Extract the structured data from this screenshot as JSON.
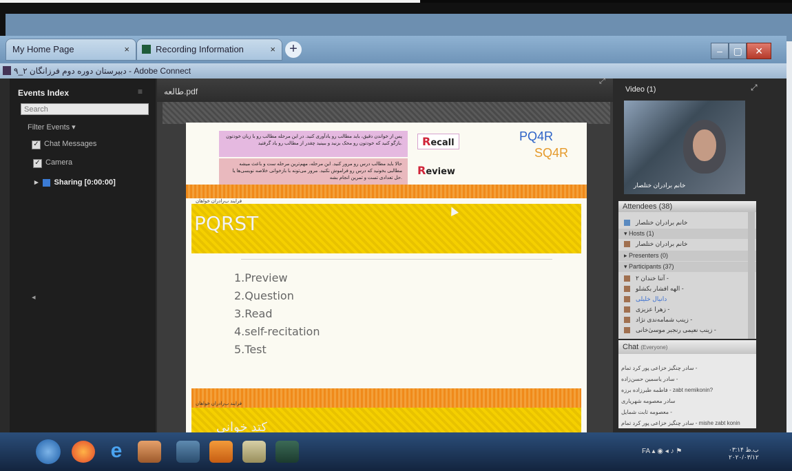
{
  "browser": {
    "tabs": [
      {
        "label": "My Home Page",
        "close": "×"
      },
      {
        "label": "Recording Information",
        "close": "×"
      }
    ],
    "new_tab": "+",
    "window_title": "دبیرستان دوره دوم فرزانگان ۲_۹ - Adobe Connect",
    "outer_controls": "- ☐ ×"
  },
  "events": {
    "title": "Events Index",
    "menu_icon": "≡",
    "search_placeholder": "Search",
    "filter_label": "Filter Events ▾",
    "items": [
      {
        "label": "Chat Messages",
        "checked": true
      },
      {
        "label": "Camera",
        "checked": true
      }
    ],
    "sharing_label": "Sharing [0:00:00]"
  },
  "share": {
    "file_title": "طالعه.pdf",
    "slide": {
      "recall_text": "پس از خواندن دقیق، باید مطالب رو یادآوری کنید. در این مرحله مطالب رو با زبان خودتون بازگو کنید که خودتون رو محک بزنید و ببینید چقدر از مطالب رو یاد گرفتید.",
      "recall_word_letter": "R",
      "recall_word_rest": "ecall",
      "review_text": "حالا باید مطالب درس رو مرور کنید. این مرحله، مهم‌ترین مرحله ست و باعث میشه مطالبی بخونید که درس رو فراموش نکنید. مرور می‌تونه با بازخوانی خلاصه نویسی‌ها یا حل تعدادی تست و تمرین انجام بشه.",
      "review_word_letter": "R",
      "review_word_rest": "eview",
      "pq4r": "PQ4R",
      "sq4r": "SQ4R",
      "topic_label": "فرایند ب‌رادران خواهان",
      "heading": "PQRST",
      "steps": [
        "1.Preview",
        "2.Question",
        "3.Read",
        "4.self-recitation",
        "5.Test"
      ],
      "footer_label": "فرایند ب‌رادران خواهان",
      "footer_title": "کتد خوانی"
    }
  },
  "video": {
    "title": "Video",
    "count": "(1)",
    "presenter_name": "خانم برادران ختلصار"
  },
  "attendees": {
    "title": "Attendees",
    "count": "(38)",
    "me": "خانم برادران ختلصار",
    "hosts_label": "Hosts (1)",
    "host_name": "خانم برادران ختلصار",
    "presenters_label": "Presenters (0)",
    "participants_label": "Participants (37)",
    "participants": [
      "آتنا خندان ۲ -",
      "الهه افشار بکشلو -",
      "دانیال خلیلی",
      "زهرا عزیزی -",
      "زینب شمامه‌ندی نژاد -",
      "زینب نعیمی رنجبر موسیٰ‌خانی -"
    ]
  },
  "chat": {
    "title": "Chat",
    "scope": "(Everyone)",
    "lines": [
      "سادر چنگیز خزاعی پور کرد تمام -",
      "سادر یاسمین حسن‌زاده -",
      "فاطمه طبرزاده برزه - zabt nemikonin?",
      "سادر معصومه شهریاری",
      "معصومه ثابت شمایل -",
      "سادر چنگیز خزاعی پور کرد تمام - mishe zabt konin"
    ]
  },
  "taskbar": {
    "clock_time": "۰۳:۱۴ ب.ظ",
    "clock_date": "۲۰۲۰/۰۳/۱۲",
    "tray_lang": "FA"
  },
  "colors": {
    "accent_blue": "#2d63c7",
    "sq4r_orange": "#e59a2b",
    "band_orange": "#f08a1a",
    "band_yellow": "#f5d000",
    "recall_pink": "#e5b9e0",
    "review_pink": "#e9b9be"
  }
}
